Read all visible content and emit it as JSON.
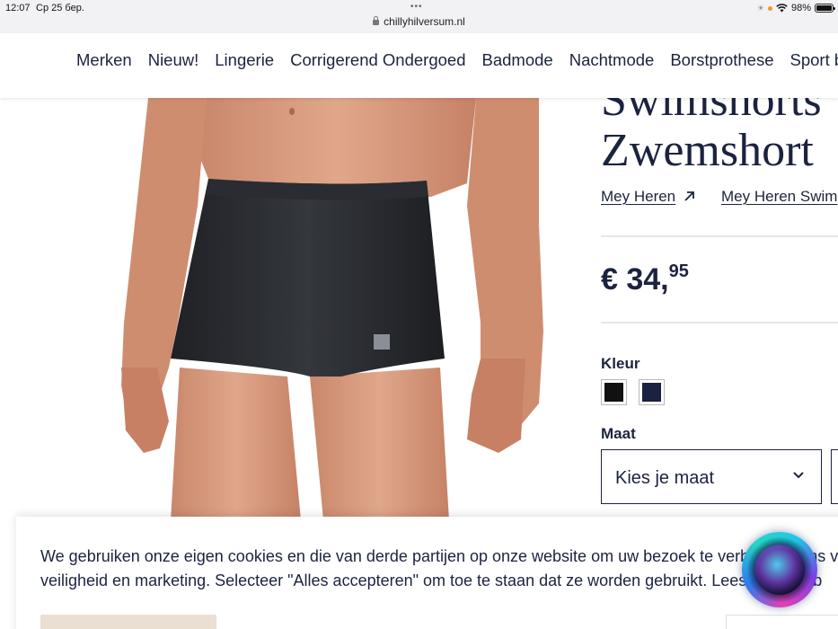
{
  "status_bar": {
    "time": "12:07",
    "date": "Ср 25 бер.",
    "url": "chillyhilversum.nl",
    "battery": "98%",
    "battery_level": 0.98
  },
  "nav": {
    "items": [
      "Merken",
      "Nieuw!",
      "Lingerie",
      "Corrigerend Ondergoed",
      "Badmode",
      "Nachtmode",
      "Borstprothese",
      "Sport bh"
    ]
  },
  "product": {
    "title_line1": "Swimshorts",
    "title_line2": "Zwemshort",
    "brand_link": "Mey Heren",
    "category_link": "Mey Heren Swim",
    "price_main": "€ 34,",
    "price_cents": "95",
    "color_label": "Kleur",
    "colors": [
      {
        "name": "zwart",
        "hex": "#111111"
      },
      {
        "name": "navy",
        "hex": "#1b2140"
      }
    ],
    "size_label": "Maat",
    "size_placeholder": "Kies je maat"
  },
  "cookie": {
    "line1": "We gebruiken onze eigen cookies en die van derde partijen op onze website om uw bezoek te verbeteren ons v",
    "line2": "veiligheid en marketing. Selecteer \"Alles accepteren\" om toe te staan dat ze worden gebruikt. Lees meer kieb"
  },
  "colors": {
    "brand_navy": "#1c2340",
    "accept_button": "#ebdfd1",
    "status_bar_bg": "#f2f2f4"
  }
}
